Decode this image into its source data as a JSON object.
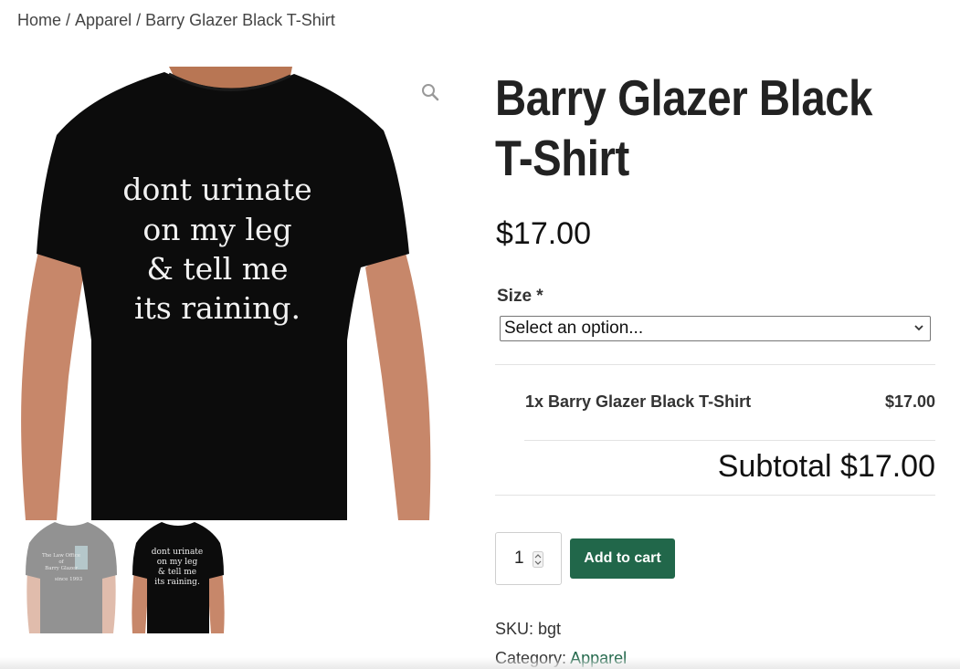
{
  "breadcrumb": {
    "home": "Home",
    "category": "Apparel",
    "current": "Barry Glazer Black T-Shirt",
    "separator": "/"
  },
  "product": {
    "title_line1": "Barry Glazer Black",
    "title_line2": "T-Shirt",
    "price": "$17.00",
    "shirt_text": [
      "dont urinate",
      "on my leg",
      "& tell me",
      "its raining."
    ],
    "thumb2_text": [
      "dont urinate",
      "on my leg",
      "& tell me",
      "its raining."
    ],
    "thumb1_text": [
      "The Law Office",
      "of",
      "Barry Glazer",
      "since 1993"
    ]
  },
  "options": {
    "size_label": "Size *",
    "size_selected": "Select an option..."
  },
  "summary": {
    "item": "1x Barry Glazer Black T-Shirt",
    "item_price": "$17.00",
    "subtotal": "Subtotal $17.00"
  },
  "cart": {
    "quantity": "1",
    "add_label": "Add to cart"
  },
  "meta": {
    "sku_label": "SKU:",
    "sku": "bgt",
    "category_label": "Category:",
    "category": "Apparel"
  },
  "colors": {
    "accent": "#21674a",
    "shirt": "#111111",
    "skin": "#c98a68"
  },
  "icons": [
    "zoom-icon",
    "chevron-down-icon",
    "spinner-arrows-icon"
  ]
}
